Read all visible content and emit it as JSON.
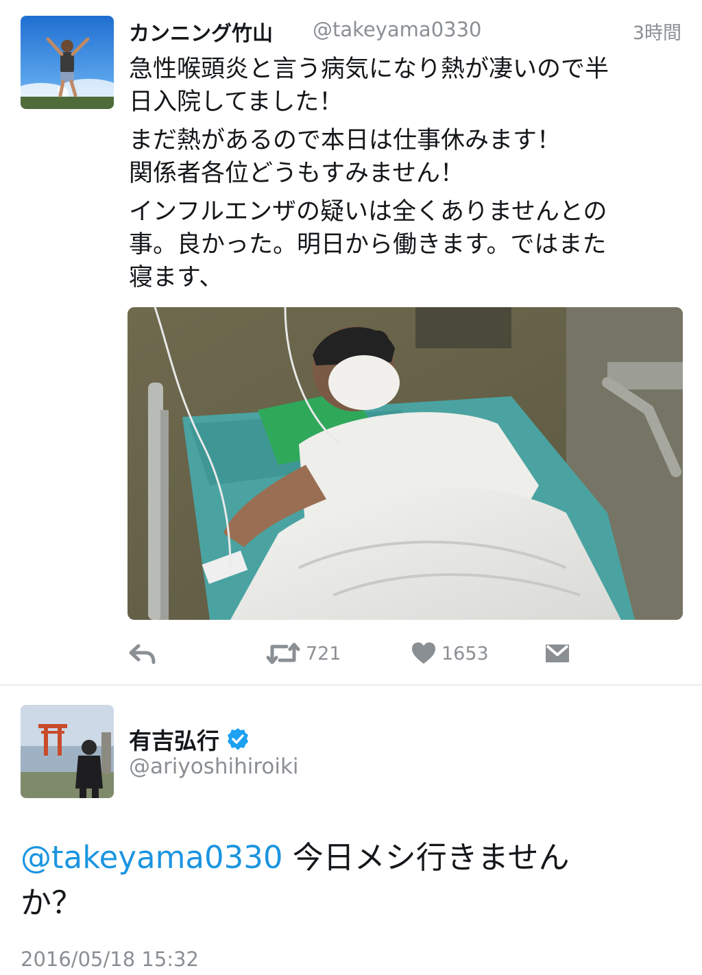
{
  "tweet1": {
    "author_name": "カンニング竹山",
    "author_handle": "@takeyama0330",
    "relative_time": "3時間",
    "text_lines": [
      "急性喉頭炎と言う病気になり熱が凄いので半\n日入院してました！",
      "まだ熱があるので本日は仕事休みます！",
      "関係者各位どうもすみません！",
      "インフルエンザの疑いは全くありませんとの\n事。良かった。明日から働きます。ではまた\n寝ます、"
    ],
    "actions": {
      "reply_icon": "reply-icon",
      "retweet_icon": "retweet-icon",
      "retweet_count": "721",
      "like_icon": "heart-icon",
      "like_count": "1653",
      "dm_icon": "envelope-icon"
    }
  },
  "tweet2": {
    "author_name": "有吉弘行",
    "verified_icon": "verified-badge-icon",
    "author_handle": "@ariyoshihiroiki",
    "mention": "@takeyama0330",
    "text": " 今日メシ行きません\nか？",
    "timestamp": "2016/05/18 15:32"
  },
  "colors": {
    "link_blue": "#1b95e0",
    "muted_gray": "#8a8f94",
    "text_dark": "#14171a",
    "verified_blue": "#1da1f2"
  }
}
